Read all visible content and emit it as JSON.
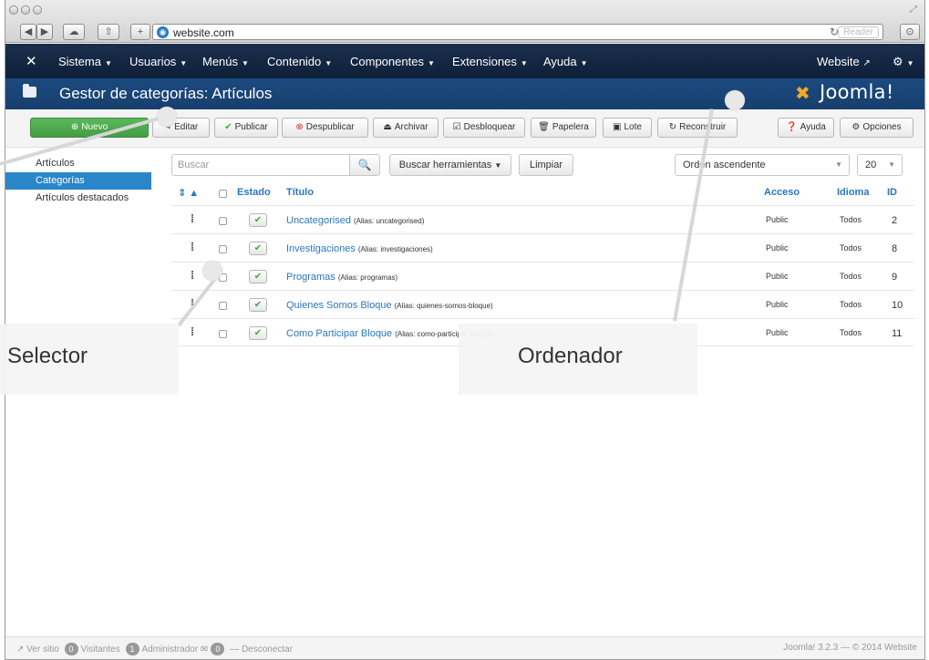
{
  "browser": {
    "url": "website.com",
    "reader_label": "Reader",
    "nav_buttons": [
      "◀",
      "▶",
      "☁",
      "⇧",
      "+"
    ]
  },
  "topnav": {
    "menus": [
      "Sistema",
      "Usuarios",
      "Menús",
      "Contenido",
      "Componentes",
      "Extensiones",
      "Ayuda"
    ],
    "site_link": "Website",
    "gear": "⚙"
  },
  "header": {
    "title": "Gestor de categorías: Artículos",
    "logo_text": "Joomla!"
  },
  "toolbar": {
    "new": "Nuevo",
    "edit": "Editar",
    "publish": "Publicar",
    "unpublish": "Despublicar",
    "archive": "Archivar",
    "unlock": "Desbloquear",
    "trash": "Papelera",
    "batch": "Lote",
    "rebuild": "Reconstruir",
    "help": "Ayuda",
    "options": "Opciones"
  },
  "sidebar": {
    "items": [
      {
        "label": "Artículos",
        "active": false
      },
      {
        "label": "Categorías",
        "active": true
      },
      {
        "label": "Artículos destacados",
        "active": false
      }
    ]
  },
  "filters": {
    "search_placeholder": "Buscar",
    "search_tools": "Buscar herramientas",
    "clear": "Limpiar",
    "ordering": "Orden ascendente",
    "limit": "20"
  },
  "table": {
    "headers": {
      "status": "Estado",
      "title": "Título",
      "access": "Acceso",
      "language": "Idioma",
      "id": "ID"
    },
    "rows": [
      {
        "title": "Uncategorised",
        "alias": "(Alias: uncategorised)",
        "access": "Public",
        "language": "Todos",
        "id": "2"
      },
      {
        "title": "Investigaciones",
        "alias": "(Alias: investigaciones)",
        "access": "Public",
        "language": "Todos",
        "id": "8"
      },
      {
        "title": "Programas",
        "alias": "(Alias: programas)",
        "access": "Public",
        "language": "Todos",
        "id": "9"
      },
      {
        "title": "Quienes Somos Bloque",
        "alias": "(Alias: quienes-somos-bloque)",
        "access": "Public",
        "language": "Todos",
        "id": "10"
      },
      {
        "title": "Como Participar Bloque",
        "alias": "(Alias: como-participar-bloque)",
        "access": "Public",
        "language": "Todos",
        "id": "11"
      }
    ]
  },
  "footer": {
    "view_site": "Ver sitio",
    "visitors_count": "0",
    "visitors": "Visitantes",
    "admin_count": "1",
    "admin": "Administrador",
    "messages_count": "0",
    "logout": "Desconectar",
    "version": "Joomla! 3.2.3 — © 2014 Website"
  },
  "annotations": {
    "selector": "Selector",
    "ordenador": "Ordenador"
  }
}
